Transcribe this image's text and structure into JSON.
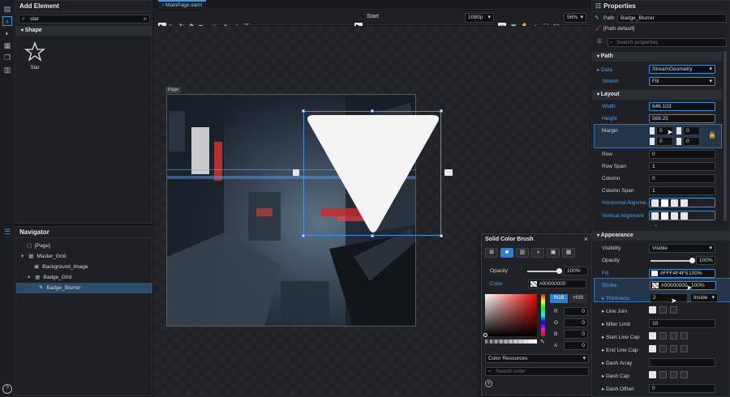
{
  "add_element": {
    "title": "Add Element",
    "search_value": "star",
    "section": "Shape",
    "items": [
      {
        "label": "Star",
        "icon": "star-icon"
      }
    ]
  },
  "navigator": {
    "title": "Navigator",
    "items": [
      {
        "label": "[Page]",
        "level": 0
      },
      {
        "label": "Master_Grid",
        "level": 1
      },
      {
        "label": "Background_Image",
        "level": 2
      },
      {
        "label": "Badge_Grid",
        "level": 2
      },
      {
        "label": "Badge_Blurrer",
        "level": 3,
        "selected": true
      }
    ]
  },
  "document": {
    "tab": "MainPage.xaml",
    "page_label": "Page",
    "start_label": "Start",
    "resolution": "1080p",
    "zoom": "56%"
  },
  "color_popup": {
    "title": "Solid Color Brush",
    "opacity_label": "Opacity",
    "opacity_value": "100%",
    "opacity_level": 1.0,
    "color_label": "Color",
    "color_value": "#00000000",
    "modes": [
      "RGB",
      "HSB"
    ],
    "channels": [
      {
        "name": "R",
        "value": "0"
      },
      {
        "name": "G",
        "value": "0"
      },
      {
        "name": "B",
        "value": "0"
      },
      {
        "name": "A",
        "value": "0"
      }
    ],
    "resources_label": "Color Resources",
    "search_placeholder": "Search color"
  },
  "properties": {
    "title": "Properties",
    "element_type": "Path",
    "element_name": "Badge_Blurrer",
    "style_text": "[Path default]",
    "search_placeholder": "Search properties",
    "path_section": "Path",
    "data_label": "Data",
    "data_value": "StreamGeometry",
    "stretch_label": "Stretch",
    "stretch_value": "Fill",
    "layout_section": "Layout",
    "width_label": "Width",
    "width_value": "646.103",
    "height_label": "Height",
    "height_value": "568.25",
    "margin_label": "Margin",
    "margin_values": [
      "0",
      "0",
      "0",
      "0"
    ],
    "row_label": "Row",
    "row_value": "0",
    "rowspan_label": "Row Span",
    "rowspan_value": "1",
    "column_label": "Column",
    "column_value": "0",
    "colspan_label": "Column Span",
    "colspan_value": "1",
    "halign_label": "Horizontal Alignme...",
    "valign_label": "Vertical Alignment",
    "appearance_section": "Appearance",
    "visibility_label": "Visibility",
    "visibility_value": "Visible",
    "opacity_label": "Opacity",
    "opacity_value": "100%",
    "opacity_level": 1.0,
    "fill_label": "Fill",
    "fill_value": "#FFF4F4F5",
    "fill_opacity": "100%",
    "stroke_label": "Stroke",
    "stroke_value": "#00000000",
    "stroke_opacity": "100%",
    "thickness_label": "Thickness",
    "thickness_value": "2",
    "stroke_position": "Inside",
    "linejoin_label": "Line Join",
    "miterlimit_label": "Miter Limit",
    "miterlimit_value": "10",
    "startcap_label": "Start Line Cap",
    "endcap_label": "End Line Cap",
    "dasharray_label": "Dash Array",
    "dashcap_label": "Dash Cap",
    "dashoffset_label": "Dash Offset",
    "dashoffset_value": "0"
  },
  "colors": {
    "accent": "#3d9ae8",
    "selection": "#2d4a66",
    "panel": "#1e2023"
  }
}
